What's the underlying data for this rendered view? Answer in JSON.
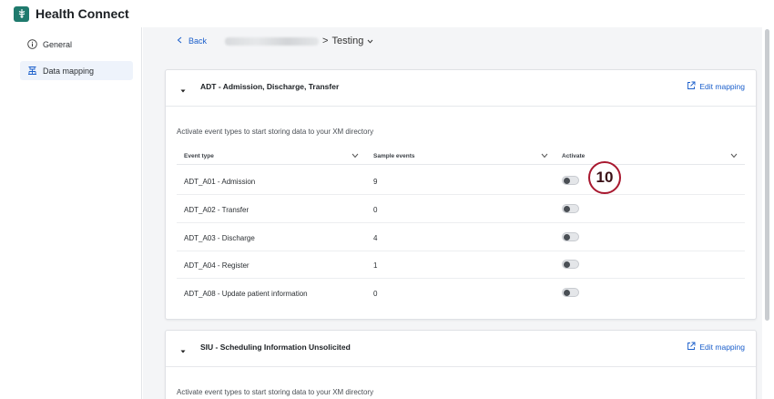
{
  "app": {
    "title": "Health Connect"
  },
  "sidebar": {
    "items": [
      {
        "label": "General",
        "icon": "info-icon",
        "active": false
      },
      {
        "label": "Data mapping",
        "icon": "data-mapping-icon",
        "active": true
      }
    ]
  },
  "breadcrumb": {
    "back_label": "Back",
    "separator": ">",
    "current": "Testing"
  },
  "sections": [
    {
      "title": "ADT - Admission, Discharge, Transfer",
      "edit_label": "Edit mapping",
      "intro": "Activate event types to start storing data to your XM directory",
      "columns": [
        "Event type",
        "Sample events",
        "Activate"
      ],
      "rows": [
        {
          "event_type": "ADT_A01 - Admission",
          "sample_events": "9",
          "active": false
        },
        {
          "event_type": "ADT_A02 - Transfer",
          "sample_events": "0",
          "active": false
        },
        {
          "event_type": "ADT_A03 - Discharge",
          "sample_events": "4",
          "active": false
        },
        {
          "event_type": "ADT_A04 - Register",
          "sample_events": "1",
          "active": false
        },
        {
          "event_type": "ADT_A08 - Update patient information",
          "sample_events": "0",
          "active": false
        }
      ]
    },
    {
      "title": "SIU - Scheduling Information Unsolicited",
      "edit_label": "Edit mapping",
      "intro": "Activate event types to start storing data to your XM directory"
    }
  ],
  "callout": {
    "label": "10",
    "color": "#a8182f"
  },
  "colors": {
    "accent": "#1b5fcb",
    "brand": "#1f7a6d",
    "active_nav_bg": "#eef3fb"
  }
}
